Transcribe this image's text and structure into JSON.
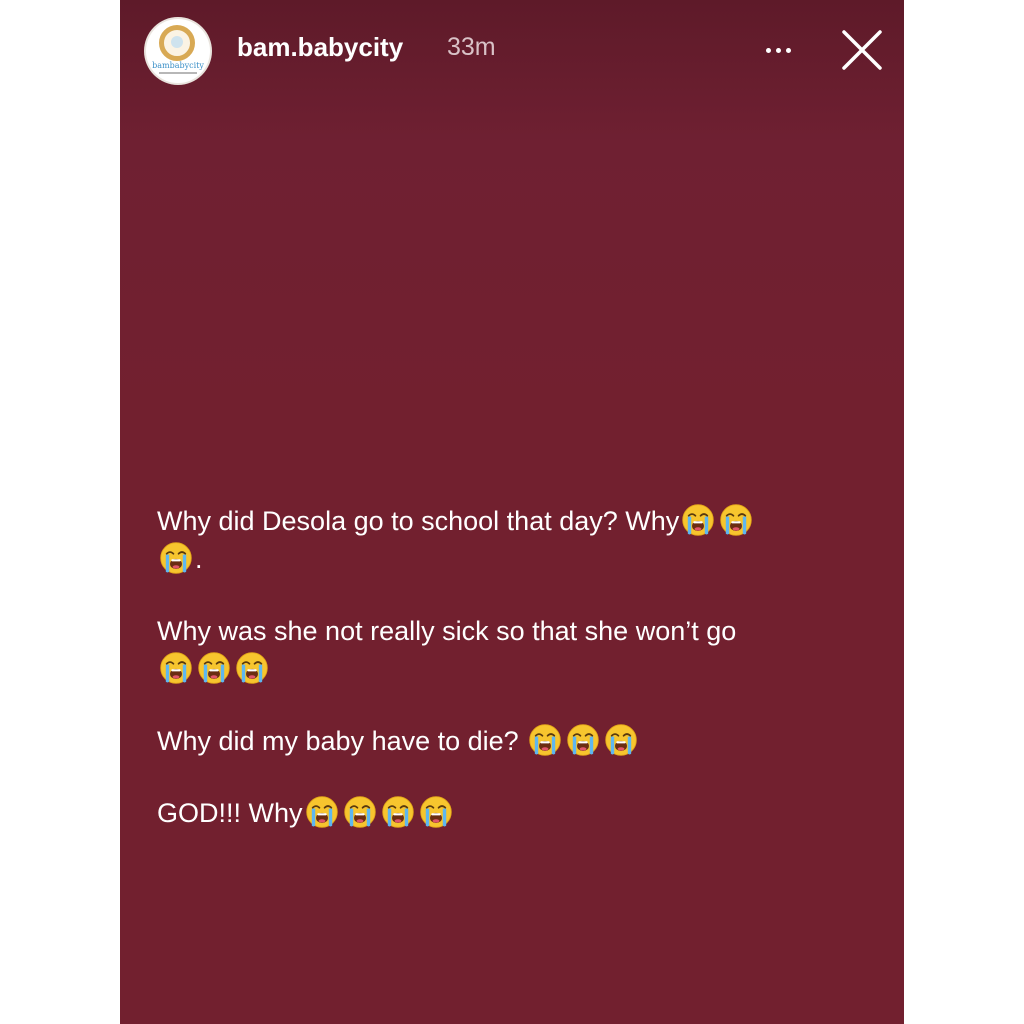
{
  "header": {
    "username": "bam.babycity",
    "timestamp": "33m",
    "avatar_wordmark": "bambabycity",
    "more_icon": "more-horizontal-icon",
    "close_icon": "close-icon"
  },
  "message": {
    "line1_text": "Why did Desola go to school that day? Why",
    "line1_tail": ".",
    "line2_text": "Why was she not really sick so that she won’t go",
    "line3_text": "Why did my baby have to die?",
    "line4_text": "GOD!!! Why",
    "emoji_name": "loudly-crying-face-emoji"
  },
  "colors": {
    "story_background": "#72202f",
    "text": "#ffffff",
    "timestamp": "#d9c2c7"
  }
}
